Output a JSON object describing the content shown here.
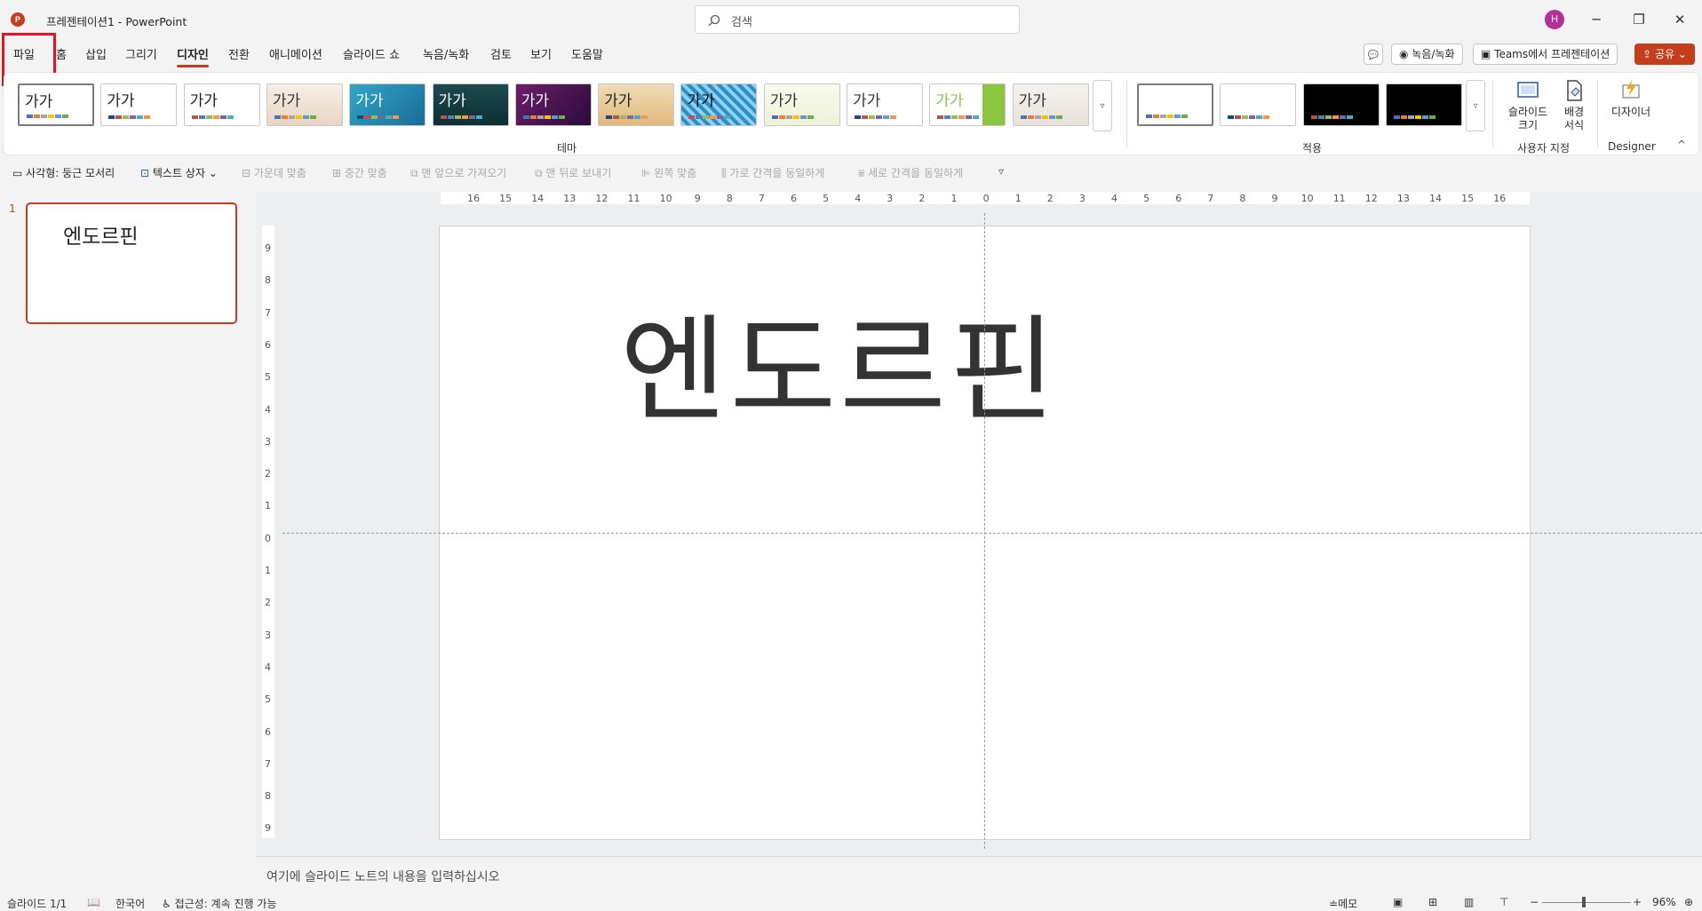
{
  "window": {
    "title": "프레젠테이션1  -  PowerPoint",
    "app_icon": "P",
    "avatar": "H",
    "search_placeholder": "검색",
    "minimize": "─",
    "restore": "❐",
    "close": "✕"
  },
  "tabs": [
    {
      "label": "파일"
    },
    {
      "label": "홈"
    },
    {
      "label": "삽입"
    },
    {
      "label": "그리기"
    },
    {
      "label": "디자인"
    },
    {
      "label": "전환"
    },
    {
      "label": "애니메이션"
    },
    {
      "label": "슬라이드 쇼"
    },
    {
      "label": "녹음/녹화"
    },
    {
      "label": "검토"
    },
    {
      "label": "보기"
    },
    {
      "label": "도움말"
    }
  ],
  "active_tab": "디자인",
  "topbar": {
    "comment_icon": "💬",
    "record_label": "녹음/녹화",
    "teams_label": "Teams에서 프레젠테이션",
    "share_label": "공유"
  },
  "ribbon": {
    "themes_label": "테마",
    "theme_preview_text": "가가",
    "variants_label": "적용",
    "customize_label": "사용자 지정",
    "slide_size": "슬라이드\n크기",
    "background_format": "배경\n서식",
    "designer_label": "Designer",
    "designer_btn": "디자이너",
    "more": "▿",
    "collapse": "^"
  },
  "format_bar": [
    {
      "label": "사각형: 둥근 모서리",
      "enabled": true
    },
    {
      "label": "텍스트 상자",
      "enabled": true
    },
    {
      "label": "가운데 맞춤",
      "enabled": false
    },
    {
      "label": "중간 맞춤",
      "enabled": false
    },
    {
      "label": "맨 앞으로 가져오기",
      "enabled": false
    },
    {
      "label": "맨 뒤로 보내기",
      "enabled": false
    },
    {
      "label": "왼쪽 맞춤",
      "enabled": false
    },
    {
      "label": "가로 간격을 동일하게",
      "enabled": false
    },
    {
      "label": "세로 간격을 동일하게",
      "enabled": false
    }
  ],
  "thumbnail": {
    "number": "1",
    "title": "엔도르핀"
  },
  "slide": {
    "title": "엔도르핀"
  },
  "ruler_h": [
    "16",
    "15",
    "14",
    "13",
    "12",
    "11",
    "10",
    "9",
    "8",
    "7",
    "6",
    "5",
    "4",
    "3",
    "2",
    "1",
    "0",
    "1",
    "2",
    "3",
    "4",
    "5",
    "6",
    "7",
    "8",
    "9",
    "10",
    "11",
    "12",
    "13",
    "14",
    "15",
    "16"
  ],
  "ruler_v": [
    "9",
    "8",
    "7",
    "6",
    "5",
    "4",
    "3",
    "2",
    "1",
    "0",
    "1",
    "2",
    "3",
    "4",
    "5",
    "6",
    "7",
    "8",
    "9"
  ],
  "notes_placeholder": "여기에 슬라이드 노트의 내용을 입력하십시오",
  "status": {
    "slide": "슬라이드 1/1",
    "language": "한국어",
    "accessibility": "접근성: 계속 진행 가능",
    "notes": "메모",
    "zoom": "96%"
  },
  "colors": {
    "accent": "#c43e1c",
    "selection": "#e81123"
  }
}
